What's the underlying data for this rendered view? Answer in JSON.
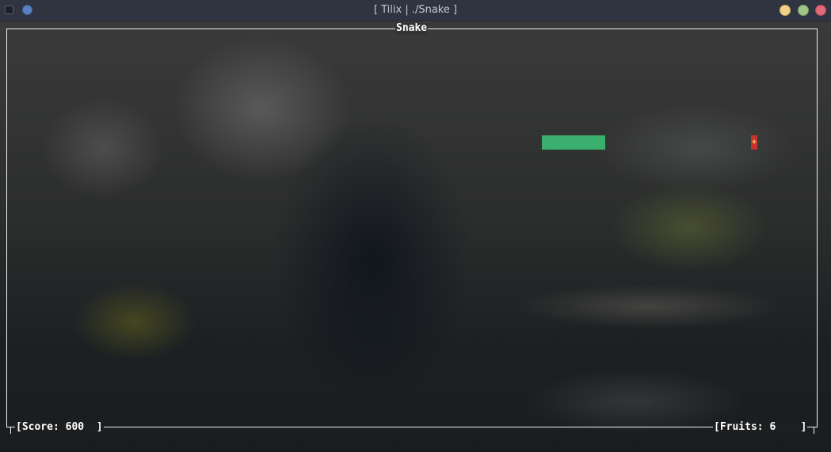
{
  "window": {
    "title": "[ Tilix | ./Snake ]"
  },
  "game": {
    "title": "Snake",
    "score_text": "[Score: 600  ]",
    "fruits_text": "[Fruits: 6    ]",
    "score": 600,
    "fruits": 6,
    "fruit_glyph": "+"
  },
  "colors": {
    "snake": "#3bb06e",
    "fruit": "#c8312d",
    "border": "#f2f2f2",
    "pin_button": "#5b7fc3",
    "minimize_button": "#efd08a",
    "maximize_button": "#9fc48a",
    "close_button": "#e0697a"
  }
}
